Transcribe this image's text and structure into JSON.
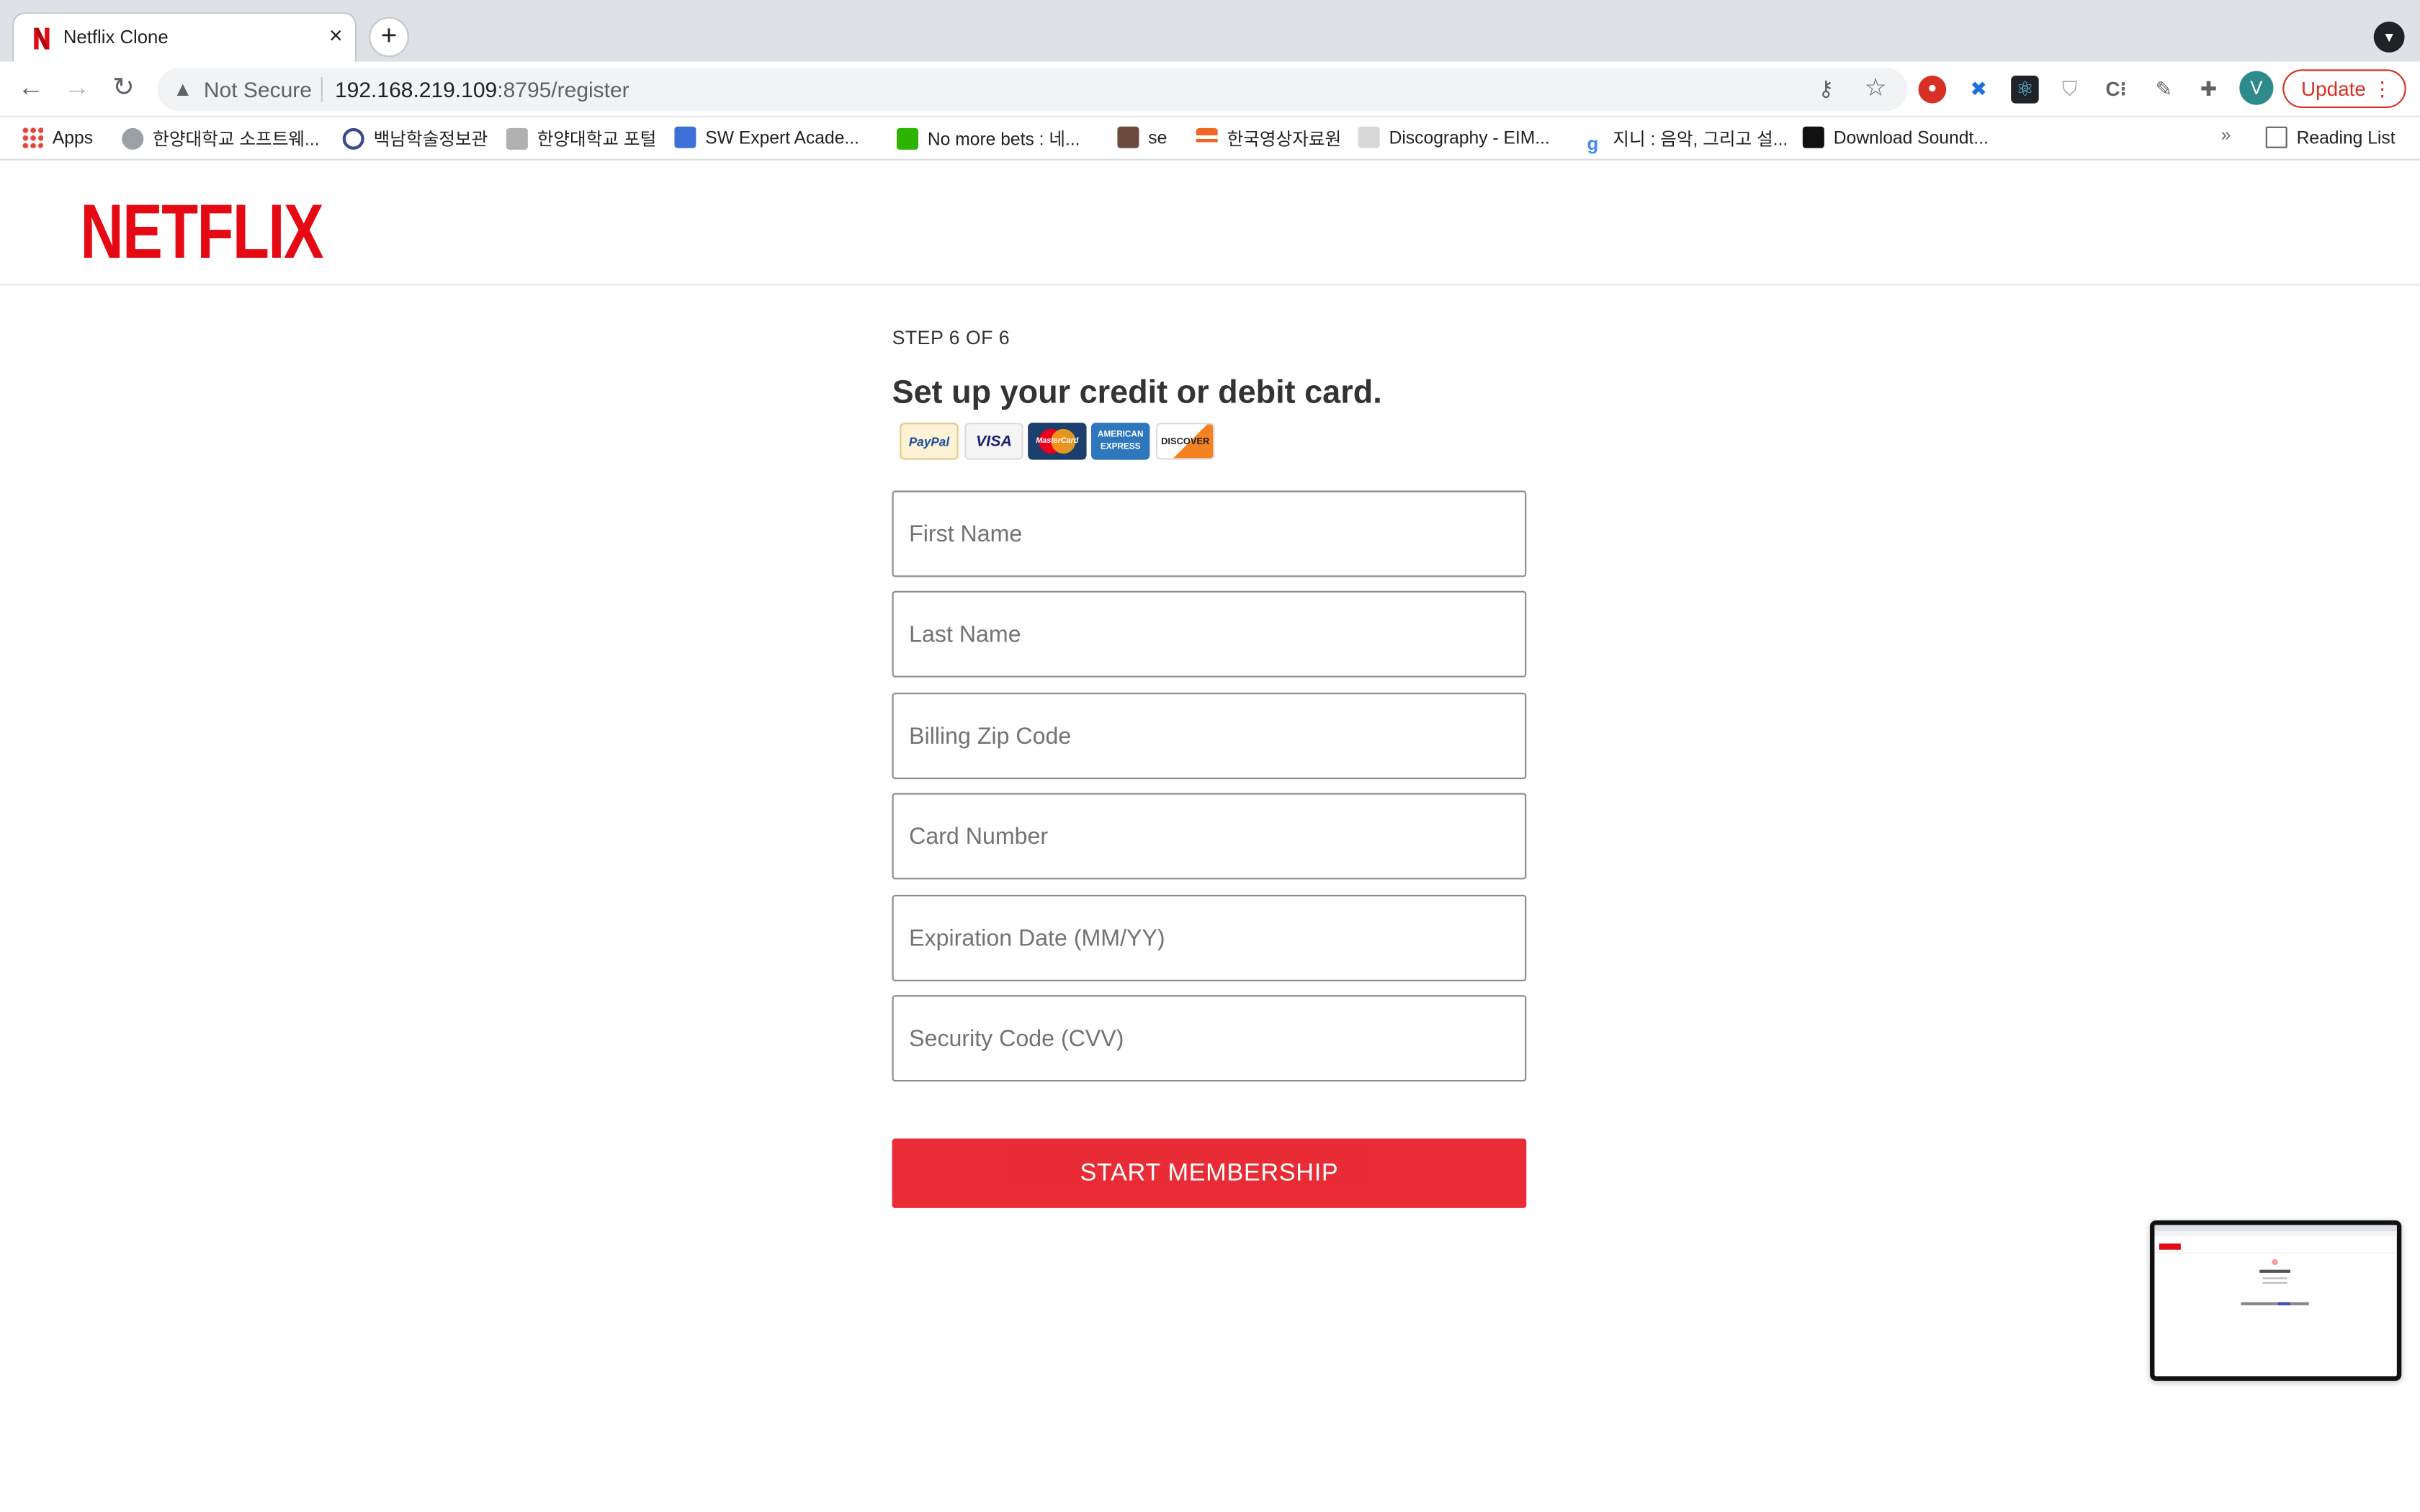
{
  "browser": {
    "tab": {
      "title": "Netflix Clone",
      "close": "×"
    },
    "new_tab": "+",
    "security": "Not Secure",
    "url_host": "192.168.219.109",
    "url_path": ":8795/register",
    "update_label": "Update",
    "bookmarks": [
      "Apps",
      "한양대학교 소프트웨...",
      "백남학술정보관",
      "한양대학교 포털",
      "SW Expert Acade...",
      "No more bets : 네...",
      "se",
      "한국영상자료원",
      "Discography - EIM...",
      "지니 : 음악, 그리고 설...",
      "Download Soundt..."
    ],
    "bookmarks_overflow": "»",
    "reading_list": "Reading List",
    "profile_initial": "V"
  },
  "page": {
    "logo": "NETFLIX",
    "step": "STEP 6 OF 6",
    "heading": "Set up your credit or debit card.",
    "payment_cards": [
      "PayPal",
      "VISA",
      "MasterCard",
      "AMERICAN EXPRESS",
      "DISCOVER"
    ],
    "fields": {
      "first_name": "First Name",
      "last_name": "Last Name",
      "zip": "Billing Zip Code",
      "card_number": "Card Number",
      "expiration": "Expiration Date (MM/YY)",
      "cvv": "Security Code (CVV)"
    },
    "submit": "START MEMBERSHIP"
  },
  "colors": {
    "brand": "#e50914",
    "update": "#d93025"
  }
}
